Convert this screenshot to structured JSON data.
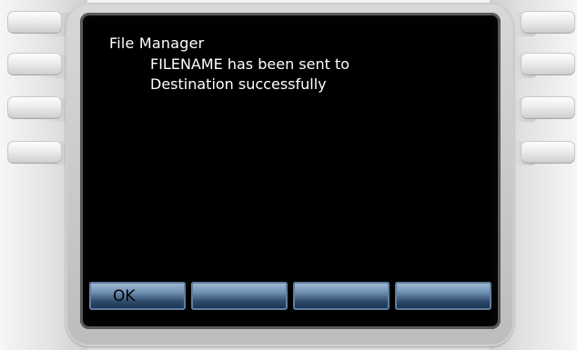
{
  "screen": {
    "title": "File Manager",
    "message_lines": [
      "FILENAME has been sent to",
      "Destination successfully"
    ]
  },
  "softkeys": [
    {
      "label": "OK"
    },
    {
      "label": ""
    },
    {
      "label": ""
    },
    {
      "label": ""
    }
  ],
  "colors": {
    "screen_bg": "#000000",
    "text": "#ffffff",
    "softkey_blue": "#6f8fb0"
  }
}
